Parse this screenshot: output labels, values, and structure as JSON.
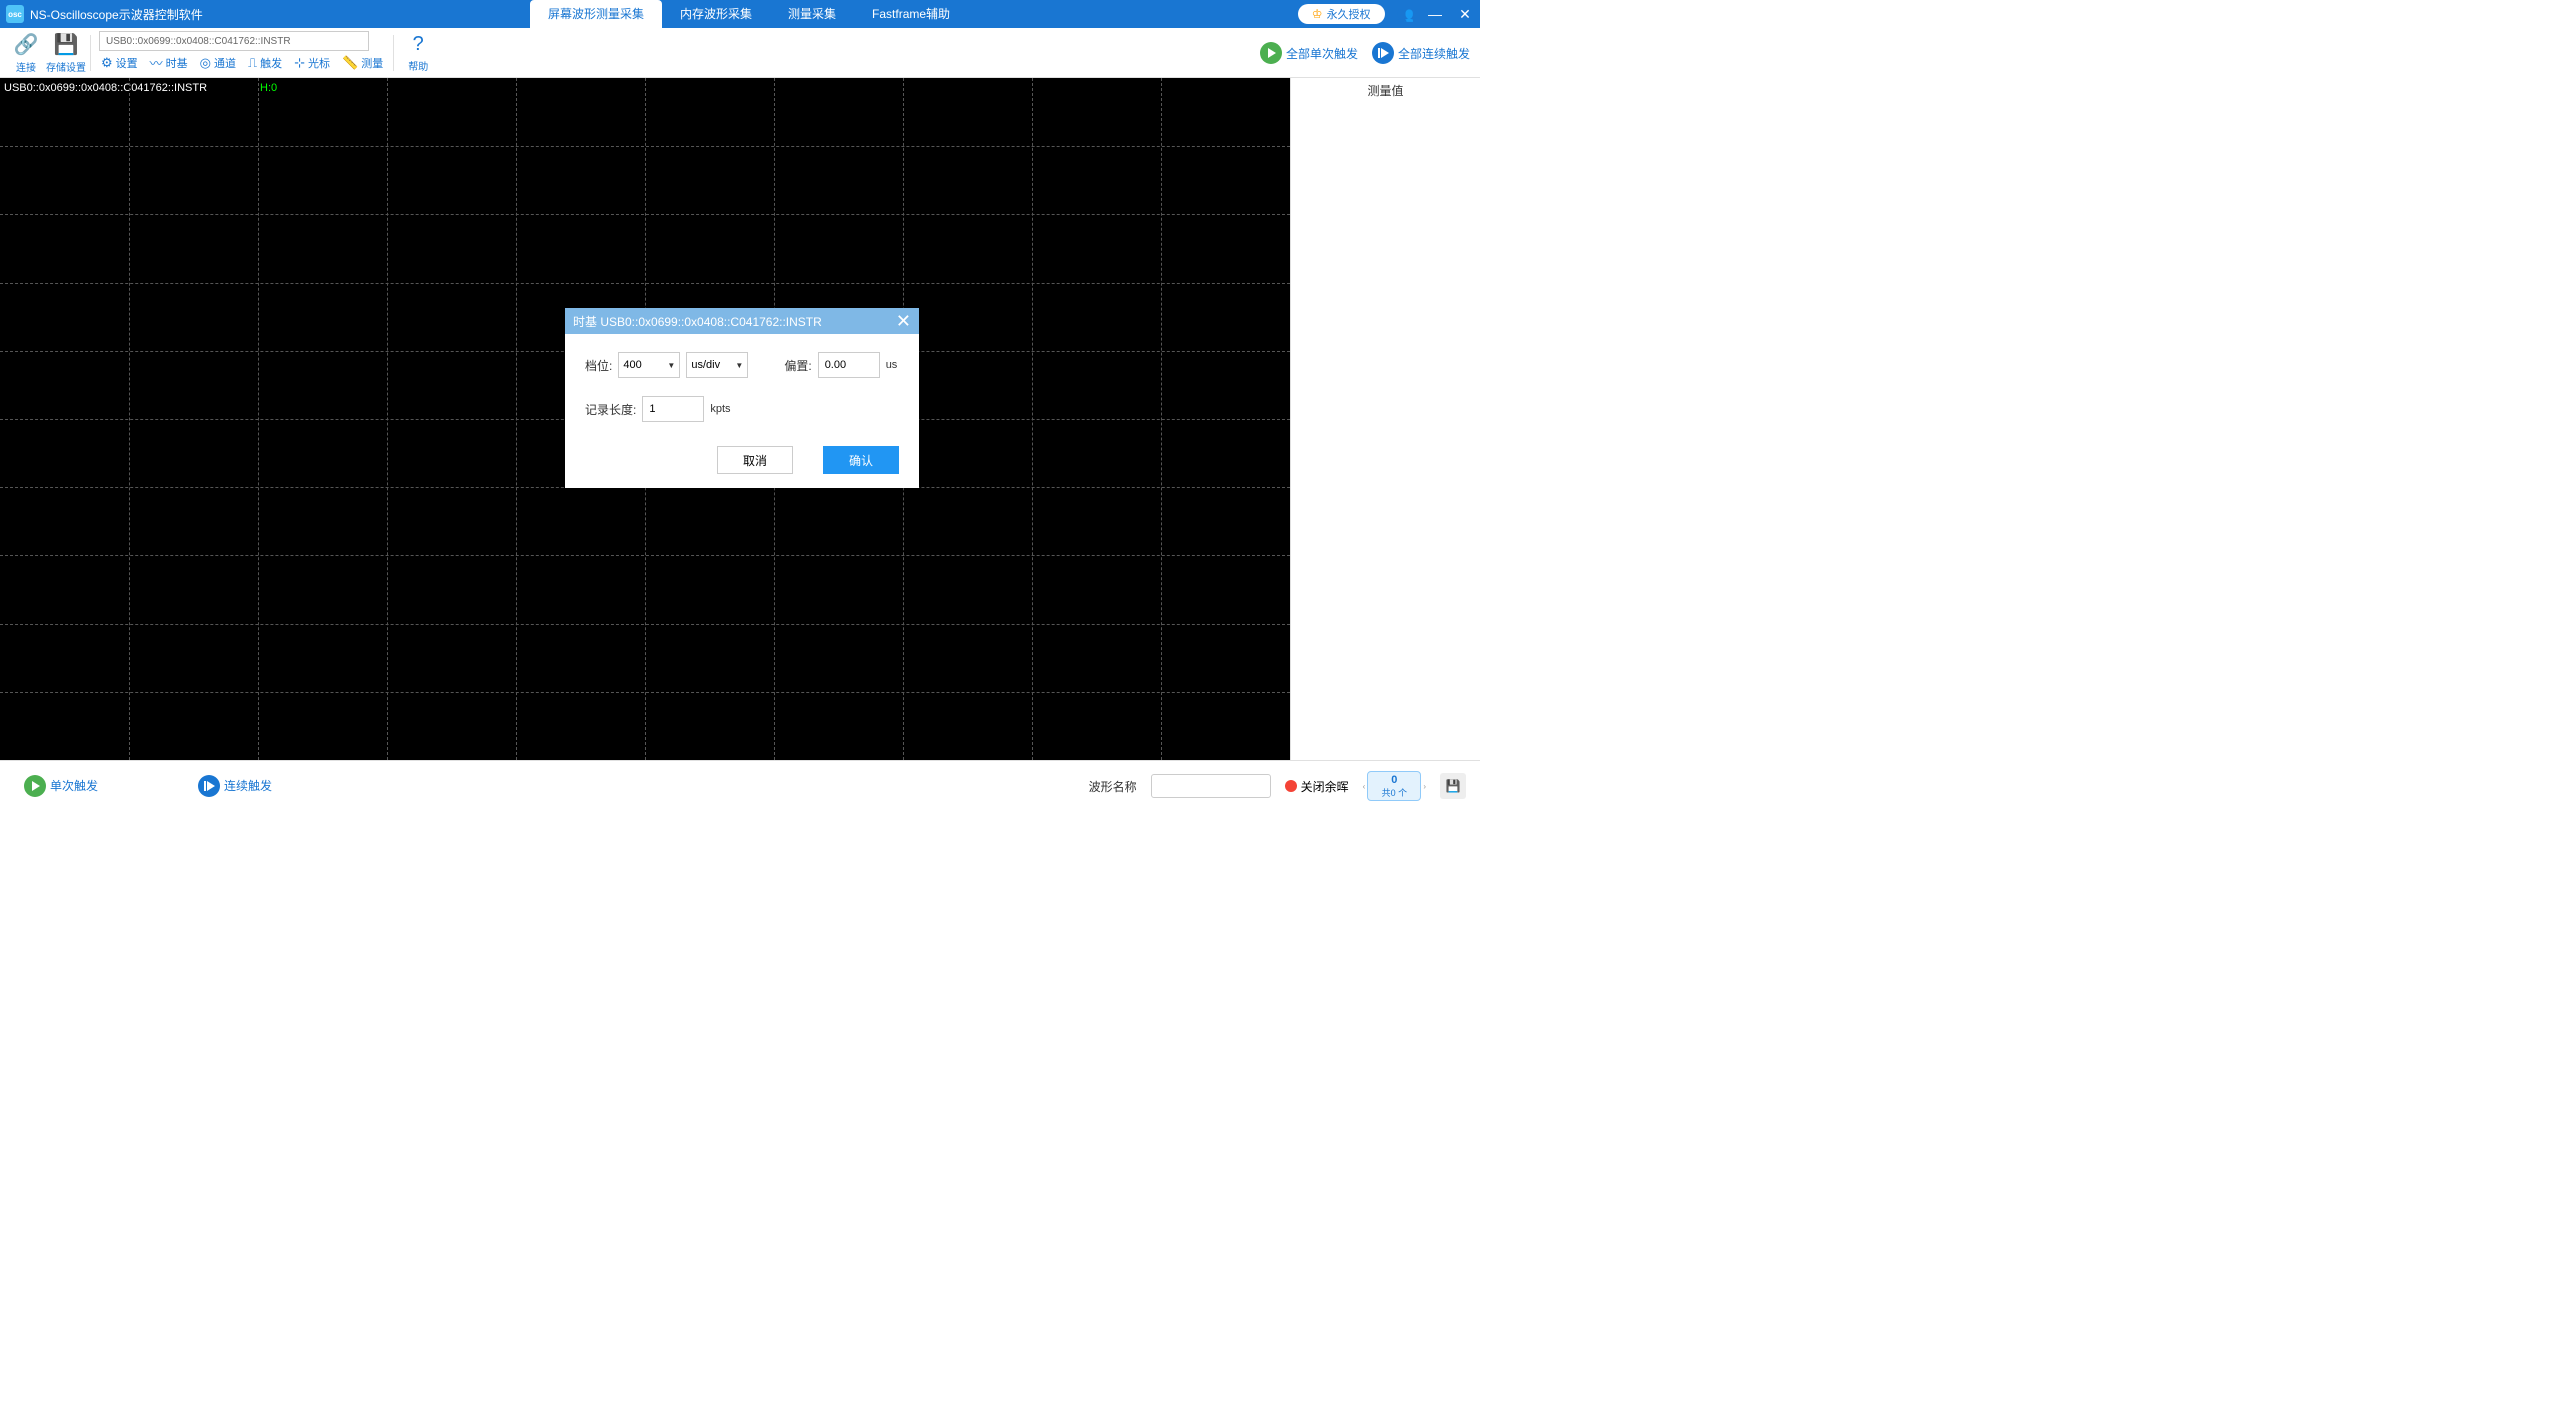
{
  "app": {
    "title": "NS-Oscilloscope示波器控制软件",
    "icon_label": "osc"
  },
  "tabs": [
    {
      "label": "屏幕波形测量采集",
      "active": true
    },
    {
      "label": "内存波形采集",
      "active": false
    },
    {
      "label": "测量采集",
      "active": false
    },
    {
      "label": "Fastframe辅助",
      "active": false
    }
  ],
  "license": {
    "label": "永久授权"
  },
  "window_controls": {
    "minimize": "—",
    "close": "✕"
  },
  "toolbar": {
    "connect": "连接",
    "storage": "存储设置",
    "address": "USB0::0x0699::0x0408::C041762::INSTR",
    "settings": "设置",
    "timebase": "时基",
    "channel": "通道",
    "trigger": "触发",
    "cursor": "光标",
    "measure": "测量",
    "help": "帮助",
    "all_single": "全部单次触发",
    "all_cont": "全部连续触发"
  },
  "scope": {
    "address": "USB0::0x0699::0x0408::C041762::INSTR",
    "h_indicator": "H:0"
  },
  "right": {
    "title": "测量值"
  },
  "dialog": {
    "title": "时基  USB0::0x0699::0x0408::C041762::INSTR",
    "scale_label": "档位:",
    "scale_value": "400",
    "scale_unit": "us/div",
    "offset_label": "偏置:",
    "offset_value": "0.00",
    "offset_unit": "us",
    "length_label": "记录长度:",
    "length_value": "1",
    "length_unit": "kpts",
    "cancel": "取消",
    "confirm": "确认"
  },
  "bottom": {
    "single": "单次触发",
    "continuous": "连续触发",
    "wave_name_label": "波形名称",
    "wave_name_value": "",
    "afterglow": "关闭余晖",
    "counter_top": "0",
    "counter_bottom": "共0 个"
  }
}
